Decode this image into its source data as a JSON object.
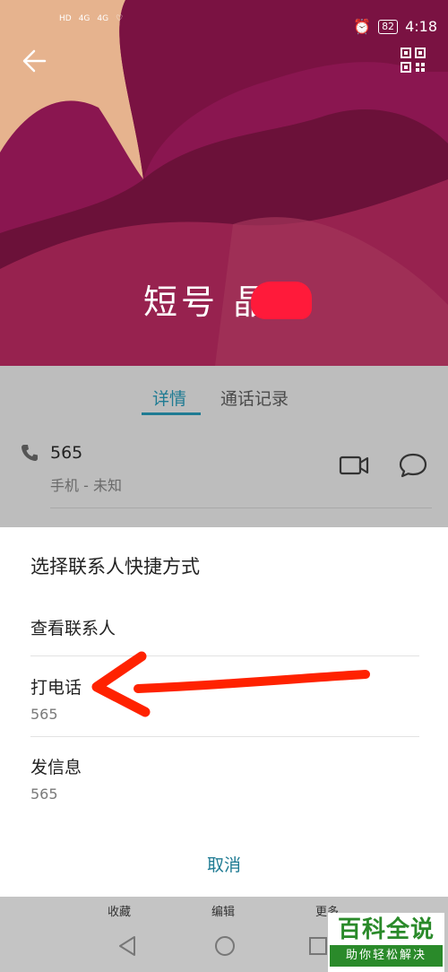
{
  "status_bar": {
    "left_badges": [
      "HD",
      "4G",
      "4G"
    ],
    "battery": "82",
    "time": "4:18"
  },
  "contact": {
    "name": "短号 晶"
  },
  "tabs": [
    {
      "label": "详情",
      "active": true
    },
    {
      "label": "通话记录",
      "active": false
    }
  ],
  "phone_entry": {
    "number": "565",
    "type": "手机 - 未知"
  },
  "sheet": {
    "title": "选择联系人快捷方式",
    "items": [
      {
        "label": "查看联系人",
        "sub": ""
      },
      {
        "label": "打电话",
        "sub": "565"
      },
      {
        "label": "发信息",
        "sub": "565"
      }
    ],
    "cancel": "取消"
  },
  "bottom_bar": {
    "actions": [
      "收藏",
      "编辑",
      "更多"
    ]
  },
  "watermark": {
    "title": "百科全说",
    "subtitle": "助你轻松解决"
  },
  "colors": {
    "accent": "#1f7b93",
    "hero": "#8d1850",
    "arrow": "#ff2200"
  },
  "icons": [
    "back-arrow-icon",
    "qr-code-icon",
    "phone-icon",
    "video-call-icon",
    "message-icon",
    "nav-back-icon",
    "nav-home-icon",
    "nav-recent-icon"
  ]
}
